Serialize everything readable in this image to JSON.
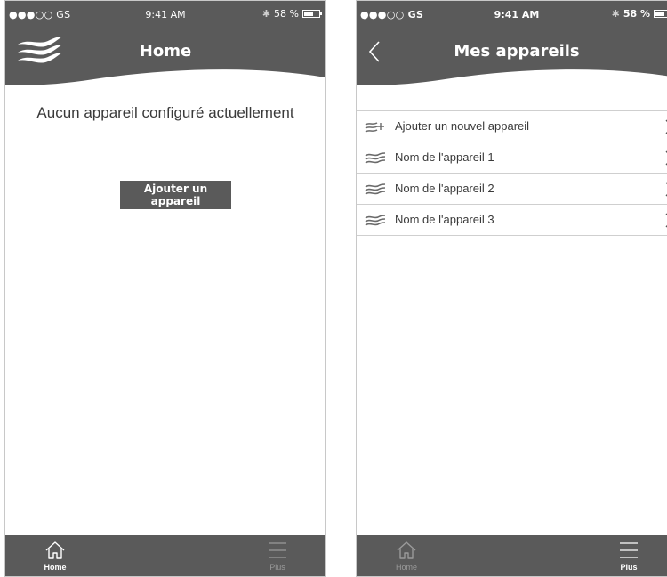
{
  "status_bar": {
    "carrier": "●●●○○ GS",
    "time": "9:41 AM",
    "battery": "58 %",
    "battery_level": 0.58
  },
  "screen_home": {
    "title": "Home",
    "empty_message": "Aucun appareil configuré actuellement",
    "add_button_label": "Ajouter un appareil"
  },
  "screen_devices": {
    "title": "Mes appareils",
    "items": [
      {
        "label": "Ajouter un nouvel appareil",
        "icon": "add-device-icon"
      },
      {
        "label": "Nom de l'appareil 1",
        "icon": "device-waves-icon"
      },
      {
        "label": "Nom de l'appareil 2",
        "icon": "device-waves-icon"
      },
      {
        "label": "Nom de l'appareil 3",
        "icon": "device-waves-icon"
      }
    ]
  },
  "tab_bar": {
    "home_label": "Home",
    "plus_label": "Plus"
  },
  "colors": {
    "bar": "#5a5a5a",
    "active_tab": "#ffffff",
    "inactive_tab": "#9a9a9a",
    "divider": "#cfcfcf"
  }
}
